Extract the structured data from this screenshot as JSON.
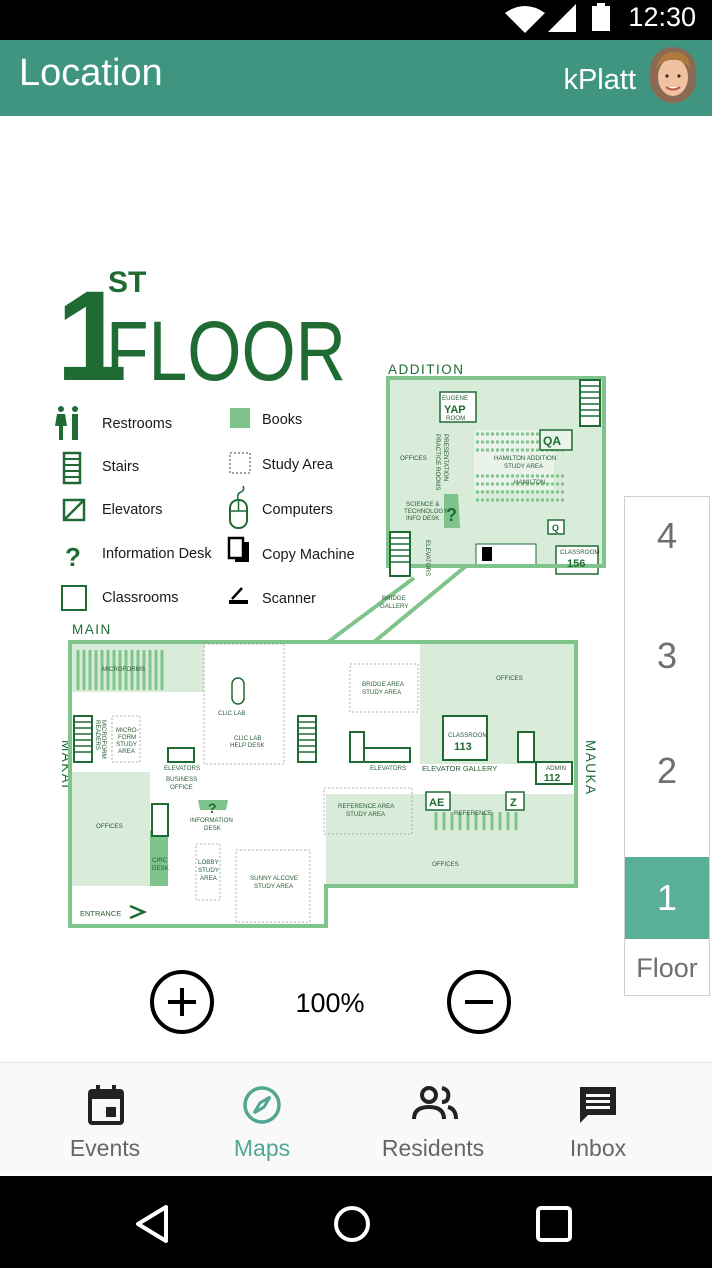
{
  "status_bar": {
    "time": "12:30"
  },
  "app_bar": {
    "title": "Location",
    "user": "kPlatt"
  },
  "map": {
    "floor_number": "1",
    "floor_suffix": "ST",
    "floor_word": "FLOOR",
    "legend": [
      {
        "icon": "restroom-icon",
        "label": "Restrooms"
      },
      {
        "icon": "stairs-icon",
        "label": "Stairs"
      },
      {
        "icon": "elevator-icon",
        "label": "Elevators"
      },
      {
        "icon": "info-desk-icon",
        "label": "Information Desk"
      },
      {
        "icon": "classroom-icon",
        "label": "Classrooms"
      },
      {
        "icon": "books-icon",
        "label": "Books"
      },
      {
        "icon": "study-area-icon",
        "label": "Study Area"
      },
      {
        "icon": "computer-icon",
        "label": "Computers"
      },
      {
        "icon": "copy-machine-icon",
        "label": "Copy Machine"
      },
      {
        "icon": "scanner-icon",
        "label": "Scanner"
      }
    ],
    "wings": {
      "addition": "ADDITION",
      "main": "MAIN",
      "makai": "MAKAI",
      "mauka": "MAUKA"
    },
    "rooms": {
      "eugene1": "EUGENE",
      "yap": "YAP",
      "room": "ROOM",
      "qa": "QA",
      "q": "Q",
      "offices": "OFFICES",
      "presentation1": "PRESENTATION",
      "presentation2": "PRACTICE ROOMS",
      "hamilton_addition1": "HAMILTON ADDITION",
      "hamilton_addition2": "STUDY AREA",
      "hamilton": "HAMILTON",
      "sci1": "SCIENCE &",
      "sci2": "TECHNOLOGY",
      "sci3": "INFO DESK",
      "elevators": "ELEVATORS",
      "classroom": "CLASSROOM",
      "c156": "156",
      "bridge_gallery1": "BRIDGE",
      "bridge_gallery2": "GALLERY",
      "microforms": "MICROFORMS",
      "microform_readers1": "MICROFORM",
      "microform_readers2": "READERS",
      "microform_study1": "MICRO-",
      "microform_study2": "FORM",
      "microform_study3": "STUDY",
      "microform_study4": "AREA",
      "clic_lab": "CLIC LAB",
      "clic_help1": "CLIC LAB",
      "clic_help2": "HELP DESK",
      "bridge_area1": "BRIDGE AREA",
      "bridge_area2": "STUDY AREA",
      "c113": "113",
      "admin": "ADMIN",
      "a112": "112",
      "elevator_gallery": "ELEVATOR GALLERY",
      "business1": "BUSINESS",
      "business2": "OFFICE",
      "information1": "INFORMATION",
      "information2": "DESK",
      "reference_area1": "REFERENCE AREA",
      "reference_area2": "STUDY AREA",
      "reference": "REFERENCE",
      "ae": "AE",
      "z": "Z",
      "circ1": "CIRC",
      "circ2": "DESK",
      "lobby1": "LOBBY",
      "lobby2": "STUDY",
      "lobby3": "AREA",
      "sunny1": "SUNNY ALCOVE",
      "sunny2": "STUDY AREA",
      "entrance": "ENTRANCE"
    }
  },
  "floor_selector": {
    "floors": [
      "4",
      "3",
      "2",
      "1"
    ],
    "active_floor": "1",
    "label": "Floor"
  },
  "zoom": {
    "level": "100%"
  },
  "bottom_nav": {
    "items": [
      {
        "label": "Events",
        "icon": "calendar-icon"
      },
      {
        "label": "Maps",
        "icon": "compass-icon"
      },
      {
        "label": "Residents",
        "icon": "people-icon"
      },
      {
        "label": "Inbox",
        "icon": "message-icon"
      }
    ],
    "active": "Maps"
  },
  "colors": {
    "primary": "#3f9580",
    "accent": "#5aaf99",
    "map_green": "#1f6b33",
    "map_fill": "#d7ead7",
    "map_wall": "#7fc48b"
  }
}
